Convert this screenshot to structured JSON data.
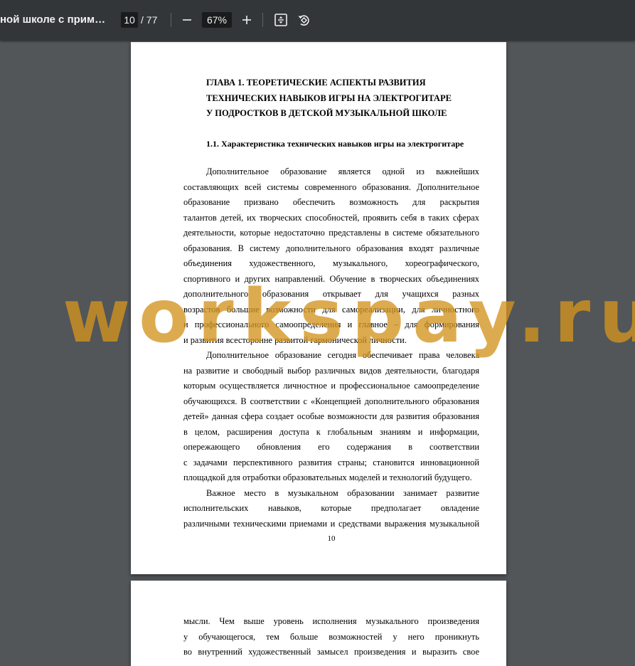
{
  "toolbar": {
    "doc_title": "ной школе с примен...",
    "current_page": "10",
    "page_total": "/ 77",
    "zoom_value": "67%",
    "zoom_out_icon": "minus-icon",
    "zoom_in_icon": "plus-icon",
    "fit_icon": "fit-page-icon",
    "rotate_icon": "rotate-icon"
  },
  "page1": {
    "heading_lines": [
      "ГЛАВА 1. ТЕОРЕТИЧЕСКИЕ АСПЕКТЫ РАЗВИТИЯ",
      "ТЕХНИЧЕСКИХ НАВЫКОВ ИГРЫ НА ЭЛЕКТРОГИТАРЕ",
      "У ПОДРОСТКОВ В ДЕТСКОЙ МУЗЫКАЛЬНОЙ ШКОЛЕ"
    ],
    "subheading": "1.1. Характеристика технических навыков игры на электрогитаре",
    "body_lines": [
      "Дополнительное образование является одной из важнейших",
      "составляющих всей системы современного образования. Дополнительное",
      "образование призвано обеспечить возможность для раскрытия",
      "талантов детей, их творческих способностей, проявить себя в таких сферах",
      "деятельности, которые недостаточно представлены в системе обязательного",
      "образования. В систему дополнительного образования входят различные",
      "объединения художественного, музыкального, хореографического,",
      "спортивного и других направлений. Обучение в творческих объединениях",
      "дополнительного образования открывает для учащихся разных",
      "возрастов большие возможности для самореализации, для личностного",
      "и профессионального самоопределения и главное – для формирования",
      "и развития всесторонне развитой гармонической личности.",
      "Дополнительное образование сегодня обеспечивает права человека",
      "на развитие и свободный выбор различных видов деятельности, благодаря",
      "которым осуществляется личностное и профессиональное самоопределение",
      "обучающихся. В соответствии с «Концепцией дополнительного образования",
      "детей» данная сфера создает особые возможности для развития образования",
      "в целом, расширения доступа к глобальным знаниям и информации,",
      "опережающего обновления его содержания в соответствии",
      "с задачами перспективного развития страны; становится инновационной",
      "площадкой для отработки образовательных моделей и технологий будущего.",
      "Важное место в музыкальном образовании занимает развитие",
      "исполнительских навыков, которые предполагает овладение",
      "различными техническими приемами и средствами выражения музыкальной"
    ],
    "page_number": "10"
  },
  "page2": {
    "body_lines": [
      "мысли. Чем выше уровень исполнения музыкального произведения",
      "у обучающегося, тем больше возможностей у него проникнуть",
      "во внутренний художественный замысел произведения и выразить свое"
    ]
  },
  "watermark": "workspay.ru"
}
